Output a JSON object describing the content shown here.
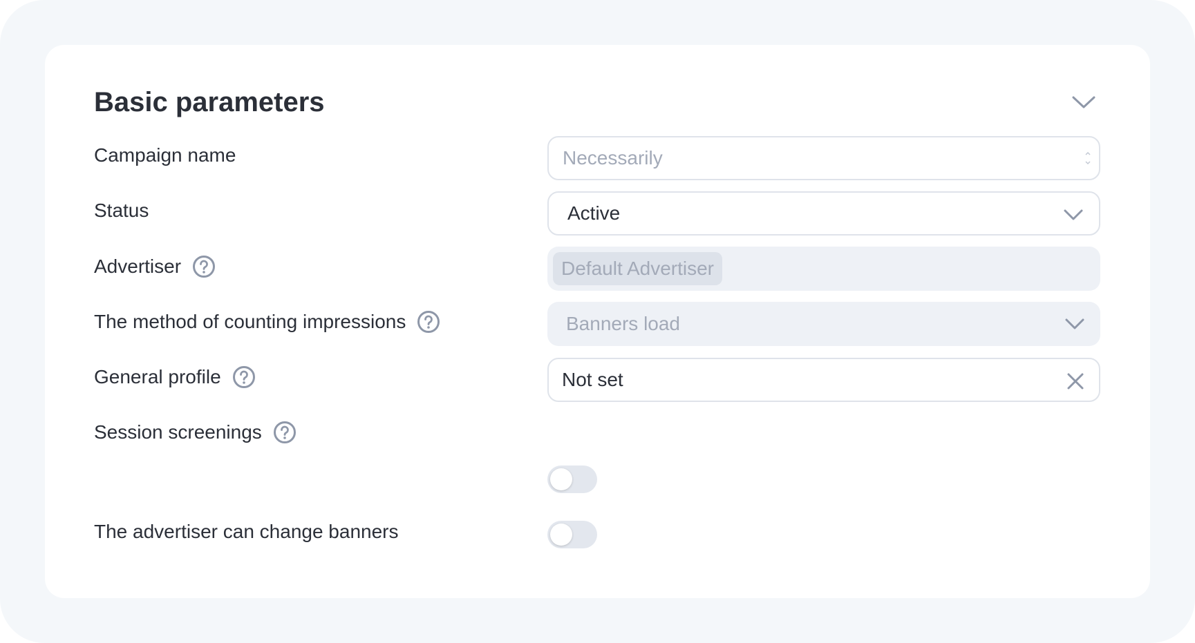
{
  "section": {
    "title": "Basic parameters",
    "collapse_icon": "chevron-down-icon"
  },
  "fields": {
    "campaign_name": {
      "label": "Campaign name",
      "value": "",
      "placeholder": "Necessarily"
    },
    "status": {
      "label": "Status",
      "value": "Active"
    },
    "advertiser": {
      "label": "Advertiser",
      "value": "Default Advertiser",
      "disabled": true
    },
    "impressions_method": {
      "label": "The method of counting impressions",
      "value": "Banners load",
      "disabled": true
    },
    "general_profile": {
      "label": "General profile",
      "value": "Not set"
    },
    "session_screenings": {
      "label": "Session screenings",
      "enabled": false
    },
    "advertiser_change_banners": {
      "label": "The advertiser can change banners",
      "enabled": false
    }
  },
  "colors": {
    "page_bg": "#f4f7fa",
    "card_bg": "#ffffff",
    "text": "#2b2f38",
    "muted": "#a3aab8",
    "icon": "#8e97a8"
  }
}
